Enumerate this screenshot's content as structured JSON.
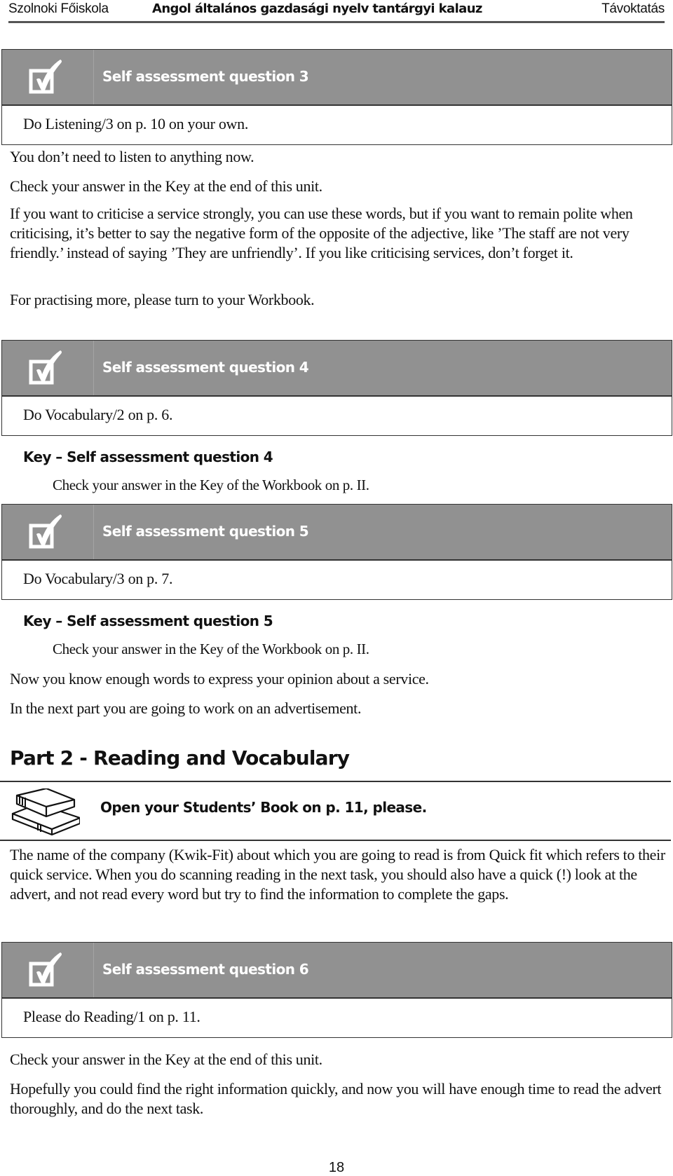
{
  "header": {
    "left": "Szolnoki Főiskola",
    "center": "Angol általános gazdasági nyelv tantárgyi kalauz",
    "right": "Távoktatás"
  },
  "saq3": {
    "icon": "checkbox-tick-icon",
    "title": "Self assessment question 3",
    "task": "Do Listening/3 on p. 10 on your own."
  },
  "paragraphs_a": [
    "You don’t need to listen to anything now.",
    "Check your answer in the Key at the end of this unit.",
    "If you want to criticise a service strongly, you can use these words, but if you want to remain polite when criticising, it’s better to say the negative form of the opposite of the adjective, like ’The staff are not very friendly.’ instead of saying ’They are unfriendly’. If you like criticising services, don’t forget it.",
    "For practising more, please turn to your Workbook."
  ],
  "saq4": {
    "icon": "checkbox-tick-icon",
    "title": "Self assessment question 4",
    "task": "Do Vocabulary/2 on p. 6.",
    "key_heading": "Key – Self assessment question 4",
    "key_text": "Check your answer in the Key of the Workbook on p. II."
  },
  "saq5": {
    "icon": "checkbox-tick-icon",
    "title": "Self assessment question 5",
    "task": "Do Vocabulary/3 on p. 7.",
    "key_heading": "Key – Self assessment question 5",
    "key_text": "Check your answer in the Key of the Workbook on p. II."
  },
  "paragraphs_b": [
    "Now you know enough words to express your opinion about a service.",
    "In the next part you are going to work on an advertisement."
  ],
  "part2": {
    "heading": "Part 2 - Reading and Vocabulary",
    "book_icon": "books-icon",
    "instruction": "Open your Students’ Book on p. 11, please.",
    "intro": "The name of the company (Kwik-Fit) about which you are going to read is from Quick fit which refers to their quick service. When you do scanning reading in the next task, you should also have a quick (!) look at the advert, and not read every word but try to find the information to complete the gaps."
  },
  "saq6": {
    "icon": "checkbox-tick-icon",
    "title": "Self assessment question 6",
    "task": "Please do Reading/1 on p. 11."
  },
  "paragraphs_c": [
    "Check your answer in the Key at the end of this unit.",
    "Hopefully you could find the right information quickly, and now you will have enough time to read the advert thoroughly, and do the next task."
  ],
  "footer": {
    "page_number": "18"
  },
  "colors": {
    "box_header": "#919191",
    "rule": "#333333"
  }
}
